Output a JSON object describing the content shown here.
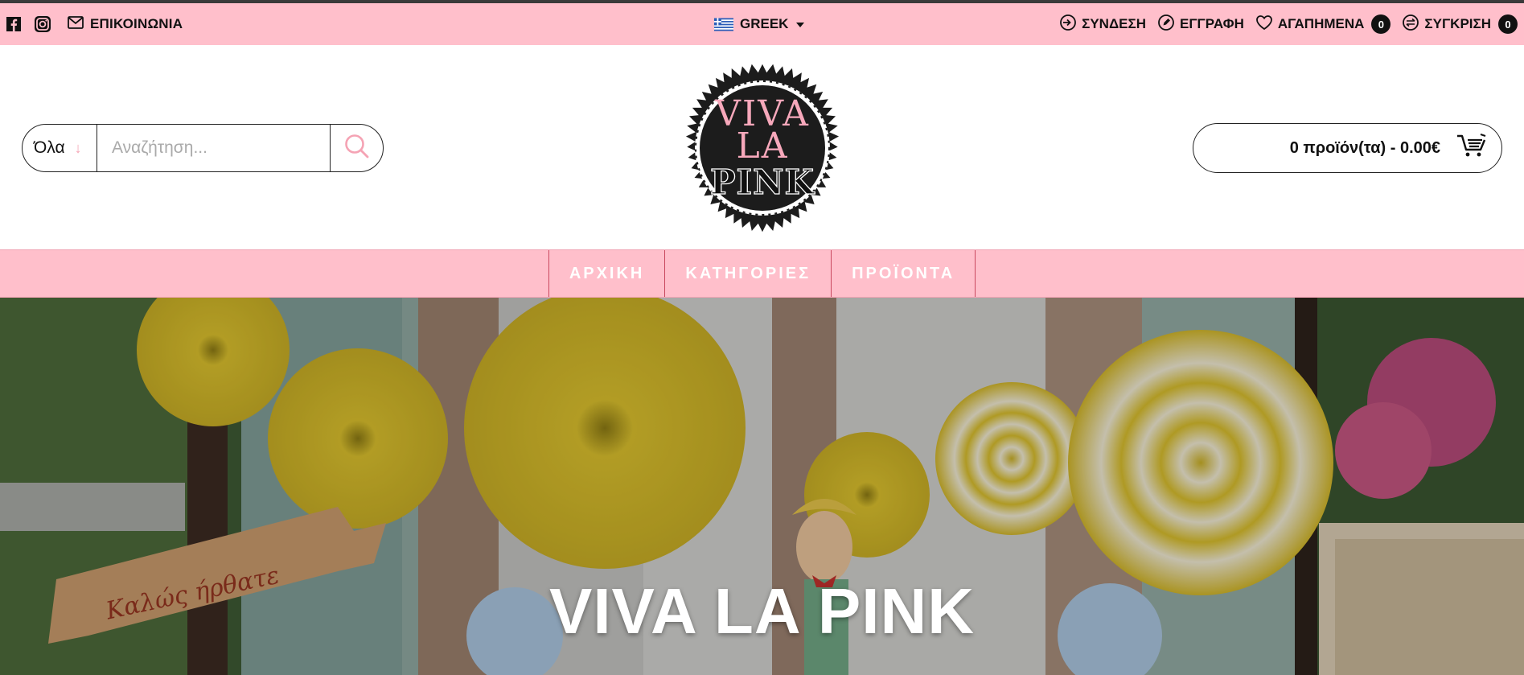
{
  "topbar": {
    "contact_label": "ΕΠΙΚΟΙΝΩΝΙΑ",
    "language_label": "GREEK",
    "login_label": "ΣΥΝΔΕΣΗ",
    "register_label": "ΕΓΓΡΑΦΗ",
    "wishlist_label": "ΑΓΑΠΗΜΕΝΑ",
    "wishlist_count": "0",
    "compare_label": "ΣΥΓΚΡΙΣΗ",
    "compare_count": "0",
    "icons": [
      "facebook-icon",
      "instagram-icon",
      "mail-icon",
      "greek-flag-icon",
      "login-icon",
      "register-icon",
      "heart-icon",
      "compare-icon"
    ]
  },
  "header": {
    "search_category": "Όλα",
    "search_placeholder": "Αναζήτηση...",
    "logo": {
      "line1": "VIVA",
      "line2": "LA",
      "line3": "PINK"
    },
    "cart_label": "0 προϊόν(τα) - 0.00€"
  },
  "nav": {
    "items": [
      {
        "label": "ΑΡΧΙΚΗ"
      },
      {
        "label": "ΚΑΤΗΓΟΡΙΕΣ"
      },
      {
        "label": "ΠΡΟΪΟΝΤΑ"
      }
    ]
  },
  "hero": {
    "title": "VIVA LA PINK",
    "sign_text": "Καλώς ήρθατε"
  },
  "colors": {
    "brand_pink": "#ffbfcb",
    "accent_pink": "#f7a8bb",
    "nav_divider": "#c9485e",
    "dark": "#111111"
  }
}
